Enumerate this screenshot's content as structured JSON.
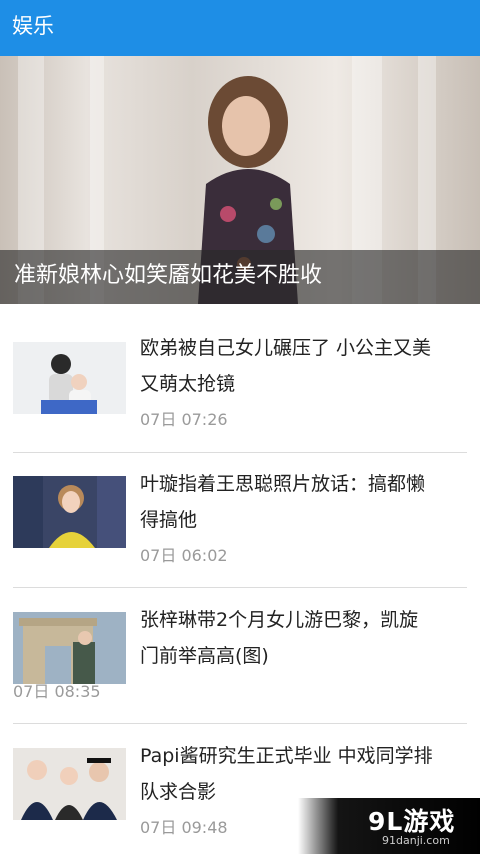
{
  "appbar": {
    "title": "娱乐"
  },
  "hero": {
    "caption": "准新娘林心如笑靥如花美不胜收"
  },
  "news": [
    {
      "line1": "欧弟被自己女儿碾压了 小公主又美",
      "line2": "又萌太抢镜",
      "time": "07日 07:26"
    },
    {
      "line1": "叶璇指着王思聪照片放话：搞都懒",
      "line2": "得搞他",
      "time": "07日 06:02"
    },
    {
      "line1": "张梓琳带2个月女儿游巴黎，凯旋",
      "line2": "门前举高高(图)",
      "time": "07日 08:35"
    },
    {
      "line1": "Papi酱研究生正式毕业 中戏同学排",
      "line2": "队求合影",
      "time": "07日 09:48"
    }
  ],
  "watermark": {
    "logo": "9L游戏",
    "site": "91danji.com"
  },
  "colors": {
    "appbar": "#1e8ee6",
    "time_text": "#9a9a9a",
    "divider": "#dcdcdc"
  }
}
